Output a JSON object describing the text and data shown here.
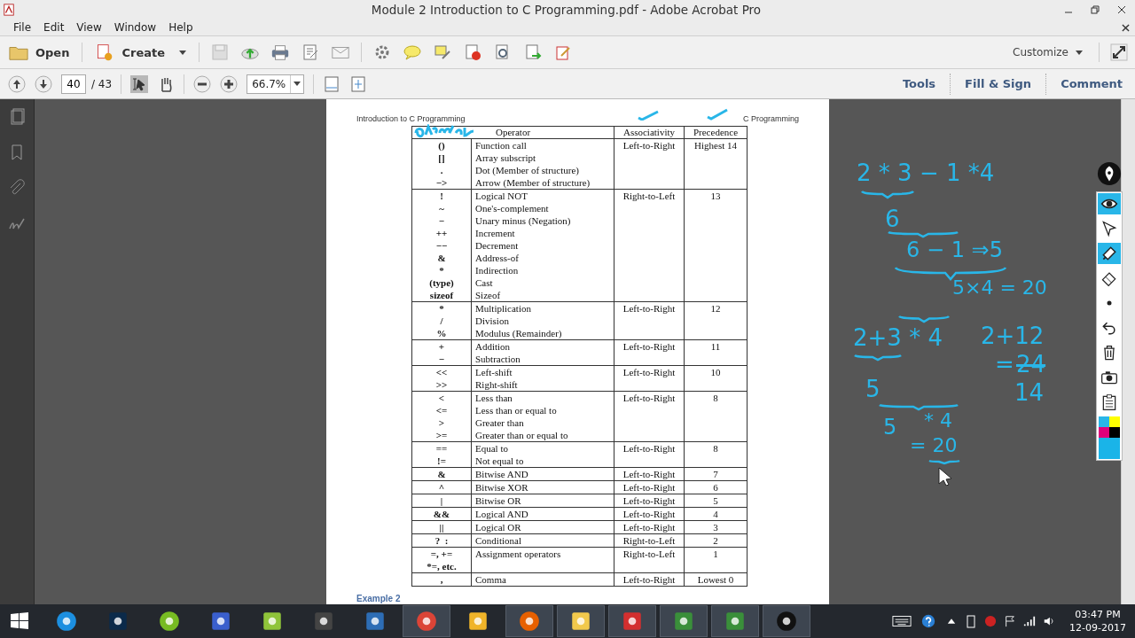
{
  "window": {
    "title": "Module 2 Introduction to C Programming.pdf - Adobe Acrobat Pro"
  },
  "menu": [
    "File",
    "Edit",
    "View",
    "Window",
    "Help"
  ],
  "toolbar": {
    "open": "Open",
    "create": "Create",
    "customize": "Customize"
  },
  "nav": {
    "page": "40",
    "total": "/ 43",
    "zoom": "66.7%"
  },
  "panes": [
    "Tools",
    "Fill & Sign",
    "Comment"
  ],
  "page": {
    "header_left": "Introduction to C Programming",
    "header_right": "C Programming",
    "footer": "Example 2",
    "columns": [
      "Operator",
      "Associativity",
      "Precedence"
    ],
    "groups": [
      {
        "rows": [
          {
            "op": "()",
            "desc": "Function call"
          },
          {
            "op": "[]",
            "desc": "Array subscript"
          },
          {
            "op": ".",
            "desc": "Dot (Member of structure)"
          },
          {
            "op": "−>",
            "desc": "Arrow (Member of structure)"
          }
        ],
        "assoc": "Left-to-Right",
        "prec": "Highest 14"
      },
      {
        "rows": [
          {
            "op": "!",
            "desc": "Logical NOT"
          },
          {
            "op": "~",
            "desc": "One's-complement"
          },
          {
            "op": "−",
            "desc": "Unary minus (Negation)"
          },
          {
            "op": "++",
            "desc": "Increment"
          },
          {
            "op": "−−",
            "desc": "Decrement"
          },
          {
            "op": "&",
            "desc": "Address-of"
          },
          {
            "op": "*",
            "desc": "Indirection"
          },
          {
            "op": "(type)",
            "desc": "Cast"
          },
          {
            "op": "sizeof",
            "desc": "Sizeof"
          }
        ],
        "assoc": "Right-to-Left",
        "prec": "13"
      },
      {
        "rows": [
          {
            "op": "*",
            "desc": "Multiplication"
          },
          {
            "op": "/",
            "desc": "Division"
          },
          {
            "op": "%",
            "desc": "Modulus (Remainder)"
          }
        ],
        "assoc": "Left-to-Right",
        "prec": "12"
      },
      {
        "rows": [
          {
            "op": "+",
            "desc": "Addition"
          },
          {
            "op": "−",
            "desc": "Subtraction"
          }
        ],
        "assoc": "Left-to-Right",
        "prec": "11"
      },
      {
        "rows": [
          {
            "op": "<<",
            "desc": "Left-shift"
          },
          {
            "op": ">>",
            "desc": "Right-shift"
          }
        ],
        "assoc": "Left-to-Right",
        "prec": "10"
      },
      {
        "rows": [
          {
            "op": "<",
            "desc": "Less than"
          },
          {
            "op": "<=",
            "desc": "Less than or equal to"
          },
          {
            "op": ">",
            "desc": "Greater than"
          },
          {
            "op": ">=",
            "desc": "Greater than or equal to"
          }
        ],
        "assoc": "Left-to-Right",
        "prec": "8"
      },
      {
        "rows": [
          {
            "op": "==",
            "desc": "Equal to"
          },
          {
            "op": "!=",
            "desc": "Not equal to"
          }
        ],
        "assoc": "Left-to-Right",
        "prec": "8"
      },
      {
        "rows": [
          {
            "op": "&",
            "desc": "Bitwise AND"
          }
        ],
        "assoc": "Left-to-Right",
        "prec": "7"
      },
      {
        "rows": [
          {
            "op": "^",
            "desc": "Bitwise XOR"
          }
        ],
        "assoc": "Left-to-Right",
        "prec": "6"
      },
      {
        "rows": [
          {
            "op": "|",
            "desc": "Bitwise OR"
          }
        ],
        "assoc": "Left-to-Right",
        "prec": "5"
      },
      {
        "rows": [
          {
            "op": "&&",
            "desc": "Logical AND"
          }
        ],
        "assoc": "Left-to-Right",
        "prec": "4"
      },
      {
        "rows": [
          {
            "op": "||",
            "desc": "Logical OR"
          }
        ],
        "assoc": "Left-to-Right",
        "prec": "3"
      },
      {
        "rows": [
          {
            "op": "?  :",
            "desc": "Conditional"
          }
        ],
        "assoc": "Right-to-Left",
        "prec": "2"
      },
      {
        "rows": [
          {
            "op": "=, +=",
            "desc": "Assignment operators"
          },
          {
            "op": "*=, etc.",
            "desc": ""
          }
        ],
        "assoc": "Right-to-Left",
        "prec": "1"
      },
      {
        "rows": [
          {
            "op": ",",
            "desc": "Comma"
          }
        ],
        "assoc": "Left-to-Right",
        "prec": "Lowest 0"
      }
    ]
  },
  "ink": [
    {
      "text": "2 * 3 − 1 *4",
      "struck": false
    },
    {
      "text": "6",
      "struck": false
    },
    {
      "text": "6 − 1 ⇒5",
      "struck": false
    },
    {
      "text": "5×4 = 20",
      "struck": false
    },
    {
      "text": "2+3 * 4",
      "struck": false
    },
    {
      "text": "2+12",
      "struck": false
    },
    {
      "text": "=",
      "struck": false
    },
    {
      "text": "24",
      "struck": true
    },
    {
      "text": "14",
      "struck": false
    },
    {
      "text": "5",
      "struck": false
    },
    {
      "text": "5",
      "struck": false
    },
    {
      "text": "* 4",
      "struck": false
    },
    {
      "text": "= 20",
      "struck": false
    }
  ],
  "ink_tools": [
    {
      "kind": "eye",
      "selected": true
    },
    {
      "kind": "cursor",
      "selected": false
    },
    {
      "kind": "highlighter",
      "selected": true
    },
    {
      "kind": "eraser",
      "selected": false
    },
    {
      "kind": "dot",
      "selected": false
    },
    {
      "kind": "undo",
      "selected": false
    },
    {
      "kind": "trash",
      "selected": false
    },
    {
      "kind": "camera",
      "selected": false
    },
    {
      "kind": "clipboard",
      "selected": false
    },
    {
      "kind": "palette",
      "selected": false
    }
  ],
  "taskbar": {
    "apps": [
      {
        "kind": "ie",
        "running": false
      },
      {
        "kind": "ps",
        "running": false
      },
      {
        "kind": "torrent",
        "running": false
      },
      {
        "kind": "loop",
        "running": false
      },
      {
        "kind": "notepad",
        "running": false
      },
      {
        "kind": "sublime",
        "running": false
      },
      {
        "kind": "network",
        "running": false
      },
      {
        "kind": "chrome",
        "running": true
      },
      {
        "kind": "bolt",
        "running": false
      },
      {
        "kind": "firefox",
        "running": true
      },
      {
        "kind": "folder",
        "running": true
      },
      {
        "kind": "acrobat",
        "running": true
      },
      {
        "kind": "camtasia",
        "running": true
      },
      {
        "kind": "camtasia",
        "running": true
      },
      {
        "kind": "pen",
        "running": true
      }
    ],
    "time": "03:47 PM",
    "date": "12-09-2017"
  }
}
